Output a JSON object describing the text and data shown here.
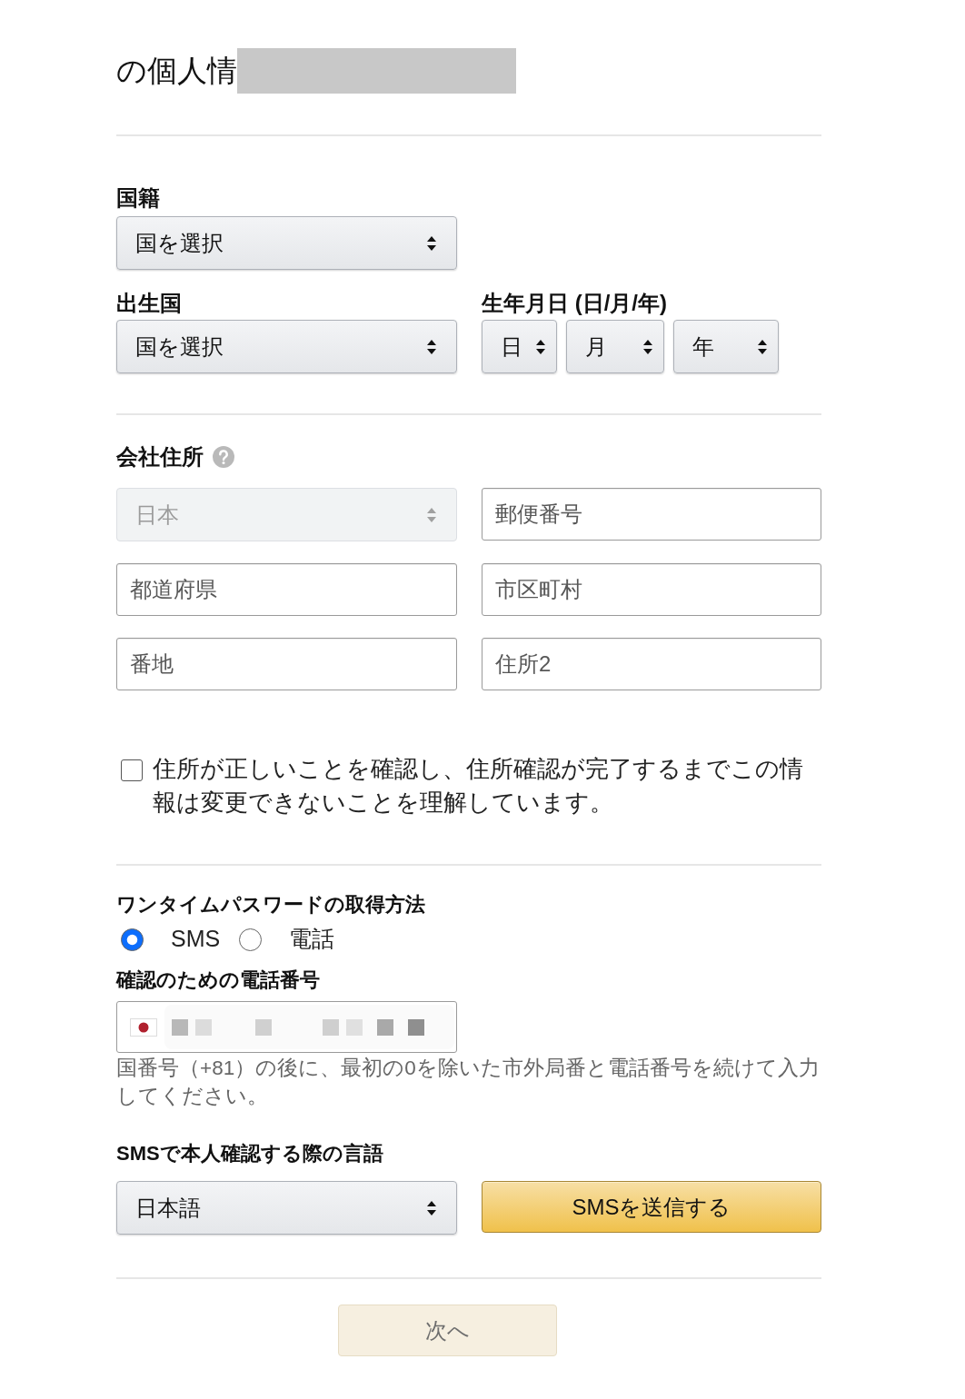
{
  "header": {
    "title": "の個人情"
  },
  "personal": {
    "nationality": {
      "label": "国籍",
      "value": "国を選択"
    },
    "birth_country": {
      "label": "出生国",
      "value": "国を選択"
    },
    "birth_date": {
      "label": "生年月日 (日/月/年)",
      "parts": [
        {
          "value": "日"
        },
        {
          "value": "月"
        },
        {
          "value": "年"
        }
      ]
    }
  },
  "company_address": {
    "label": "会社住所",
    "fields": [
      {
        "kind": "select",
        "value": "日本",
        "disabled": true
      },
      {
        "kind": "input",
        "placeholder": "郵便番号"
      },
      {
        "kind": "input",
        "placeholder": "都道府県"
      },
      {
        "kind": "input",
        "placeholder": "市区町村"
      },
      {
        "kind": "input",
        "placeholder": "番地"
      },
      {
        "kind": "input",
        "placeholder": "住所2"
      }
    ]
  },
  "confirmation": {
    "text": "住所が正しいことを確認し、住所確認が完了するまでこの情報は変更できないことを理解しています。",
    "checked": false
  },
  "otp_method": {
    "label": "ワンタイムパスワードの取得方法",
    "options": [
      {
        "label": "SMS",
        "selected": true
      },
      {
        "label": "電話",
        "selected": false
      }
    ]
  },
  "phone": {
    "label": "確認のための電話番号",
    "hint": "国番号（+81）の後に、最初の0を除いた市外局番と電話番号を続けて入力してください。"
  },
  "sms_language": {
    "label": "SMSで本人確認する際の言語",
    "value": "日本語",
    "button": "SMSを送信する"
  },
  "next_button": {
    "label": "次へ",
    "disabled": true
  }
}
